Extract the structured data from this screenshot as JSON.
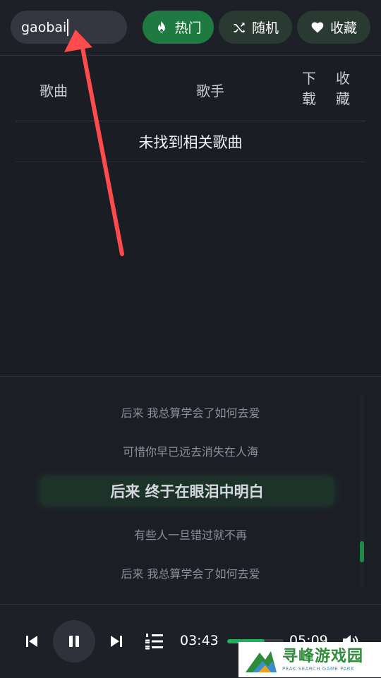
{
  "search": {
    "value": "gaobai"
  },
  "tabs": {
    "hot": {
      "label": "热门",
      "icon": "fire-icon"
    },
    "random": {
      "label": "随机",
      "icon": "shuffle-icon"
    },
    "favorites": {
      "label": "收藏",
      "icon": "heart-icon"
    }
  },
  "table": {
    "headers": {
      "song": "歌曲",
      "singer": "歌手",
      "download": "下载",
      "favorite": "收藏"
    },
    "empty_message": "未找到相关歌曲"
  },
  "lyrics": {
    "lines": [
      "后来 我总算学会了如何去爱",
      "可惜你早已远去消失在人海",
      "后来 终于在眼泪中明白",
      "有些人一旦错过就不再",
      "后来 我总算学会了如何去爱"
    ],
    "active_index": 2,
    "scroll_position": 0.85
  },
  "player": {
    "current_time": "03:43",
    "total_time": "05:09",
    "progress": 0.66,
    "state": "playing"
  },
  "watermark": {
    "cn": "寻峰游戏园",
    "en": "PEAK SEARCH GAME PARK"
  },
  "colors": {
    "accent": "#1f7a42",
    "progress": "#22b05a",
    "annotation_arrow": "#ff4b4b"
  }
}
